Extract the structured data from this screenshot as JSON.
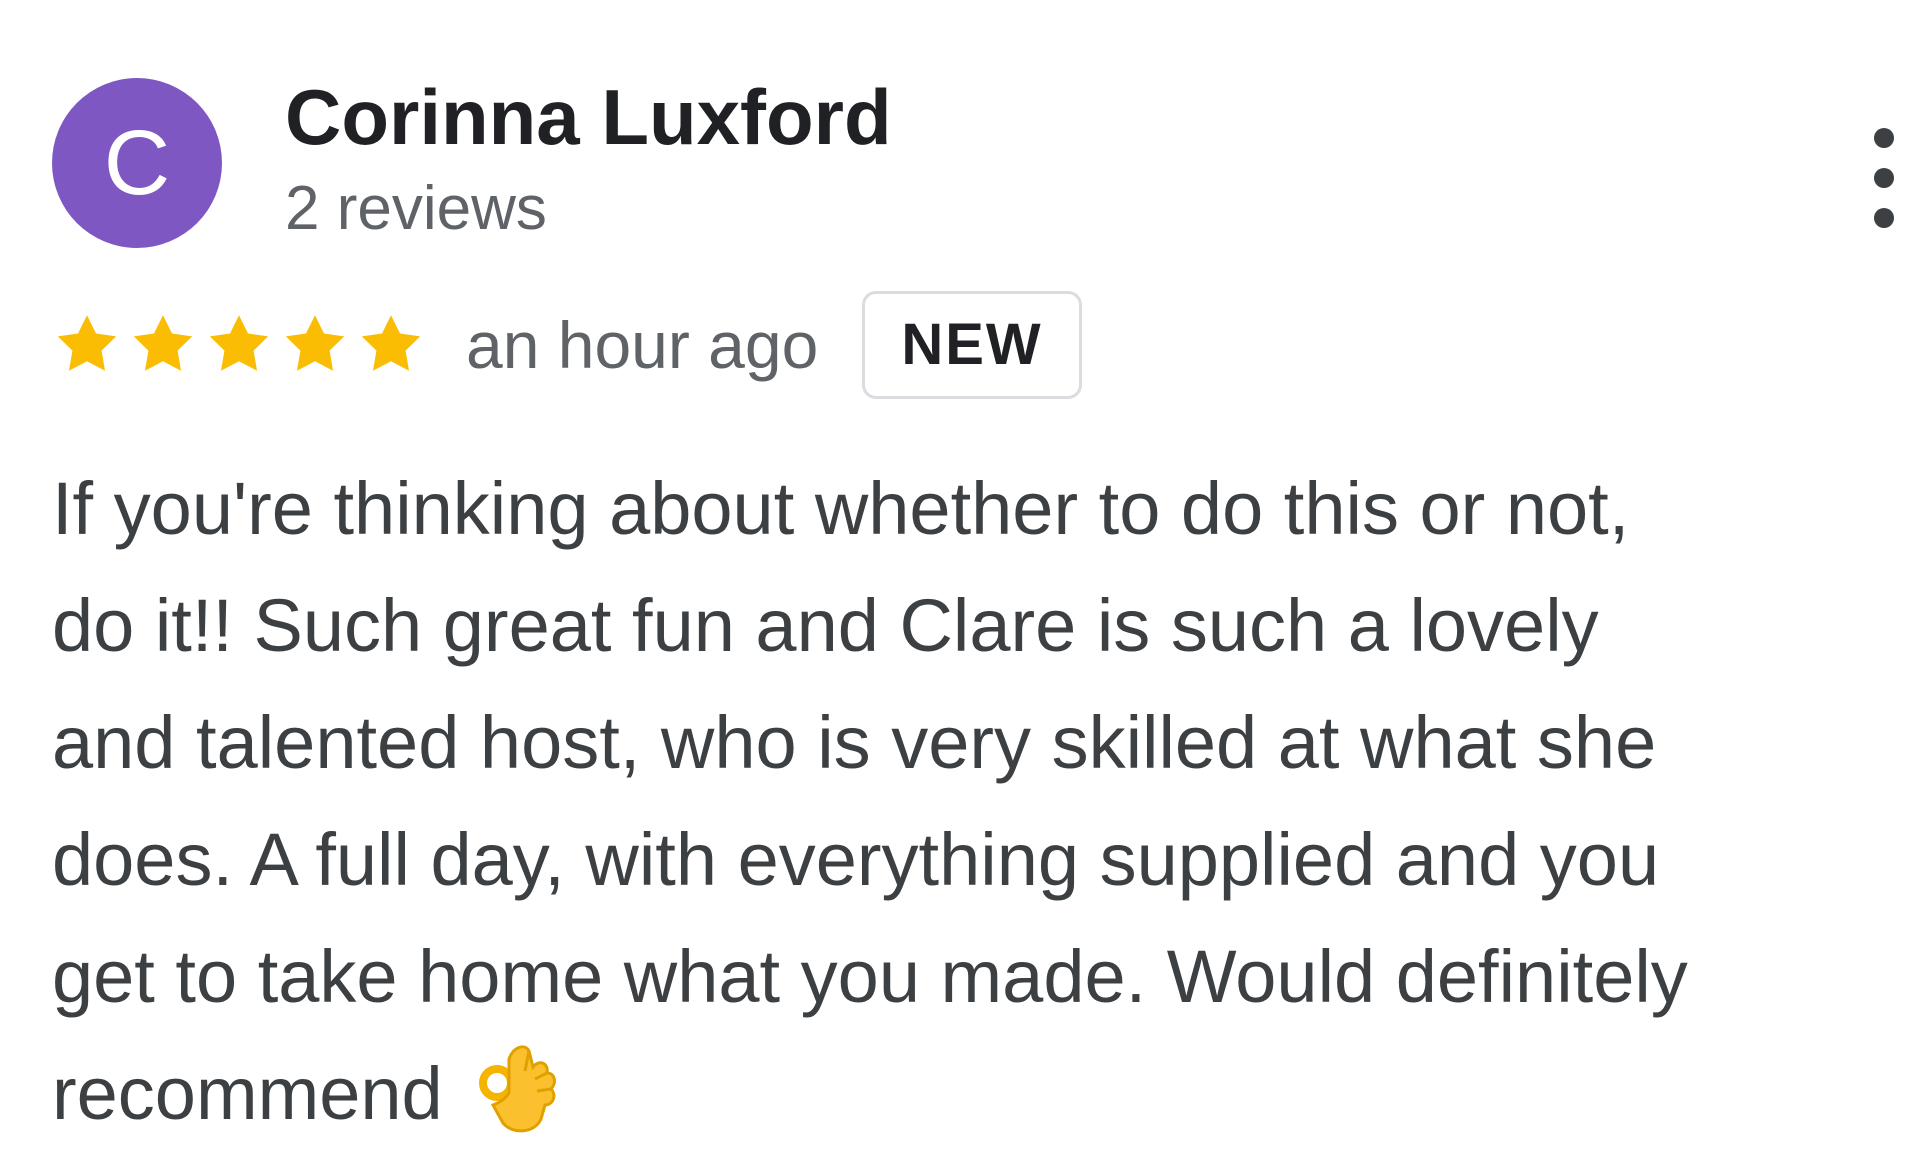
{
  "review": {
    "author": {
      "initial": "C",
      "name": "Corinna Luxford",
      "review_count": "2 reviews",
      "avatar_color": "#7e57c2"
    },
    "rating": {
      "stars": 5,
      "max_stars": 5,
      "star_color": "#fbbc04"
    },
    "time_ago": "an hour ago",
    "badge": "NEW",
    "more_icon": "more-vert-icon",
    "text_lines": [
      "If you're thinking about whether to do this or not,",
      "do it!! Such great fun and Clare is such a lovely",
      "and talented host, who is very skilled at what she",
      "does. A full day, with everything supplied and you",
      "get to take home what you made. Would definitely",
      "recommend"
    ],
    "emoji": "ok-hand-icon"
  }
}
